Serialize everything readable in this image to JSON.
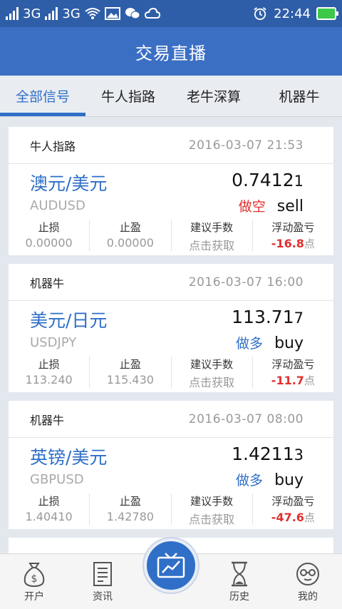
{
  "status_bar": {
    "network1": "3G",
    "network2": "3G",
    "time": "22:44"
  },
  "header": {
    "title": "交易直播"
  },
  "tabs": [
    {
      "label": "全部信号",
      "active": true
    },
    {
      "label": "牛人指路",
      "active": false
    },
    {
      "label": "老牛深算",
      "active": false
    },
    {
      "label": "机器牛",
      "active": false
    }
  ],
  "stat_labels": {
    "stop_loss": "止损",
    "take_profit": "止盈",
    "lots": "建议手数",
    "float_pl": "浮动盈亏"
  },
  "signals": [
    {
      "source": "牛人指路",
      "time": "2016-03-07 21:53",
      "pair_name": "澳元/美元",
      "pair_code": "AUDUSD",
      "price_main": "0.7412",
      "price_last": "1",
      "direction_cn": "做空",
      "direction_en": "sell",
      "direction_type": "short",
      "stop_loss": "0.00000",
      "take_profit": "0.00000",
      "lots": "点击获取",
      "float_pl": "-16.8",
      "float_unit": "点"
    },
    {
      "source": "机器牛",
      "time": "2016-03-07 16:00",
      "pair_name": "美元/日元",
      "pair_code": "USDJPY",
      "price_main": "113.71",
      "price_last": "7",
      "direction_cn": "做多",
      "direction_en": "buy",
      "direction_type": "long",
      "stop_loss": "113.240",
      "take_profit": "115.430",
      "lots": "点击获取",
      "float_pl": "-11.7",
      "float_unit": "点"
    },
    {
      "source": "机器牛",
      "time": "2016-03-07 08:00",
      "pair_name": "英镑/美元",
      "pair_code": "GBPUSD",
      "price_main": "1.4211",
      "price_last": "3",
      "direction_cn": "做多",
      "direction_en": "buy",
      "direction_type": "long",
      "stop_loss": "1.40410",
      "take_profit": "1.42780",
      "lots": "点击获取",
      "float_pl": "-47.6",
      "float_unit": "点"
    }
  ],
  "bottom_nav": {
    "open_account": "开户",
    "news": "资讯",
    "history": "历史",
    "mine": "我的"
  },
  "colors": {
    "primary": "#3b6fc4",
    "accent": "#2f6fc8",
    "loss": "#e0302f"
  }
}
